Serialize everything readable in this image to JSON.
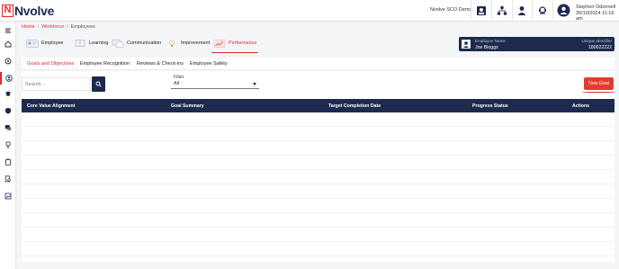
{
  "brand": {
    "mark": "N",
    "name": "Nvolve"
  },
  "header": {
    "org_name": "Nvolve SCO Demo",
    "icons": [
      "id-card-icon",
      "org-chart-icon",
      "users-icon",
      "support-icon"
    ],
    "user_name": "Stephen Odonnell",
    "user_datetime": "30/10/2024 11:16 am"
  },
  "sidebar": {
    "items": [
      {
        "icon": "menu-toggle-icon"
      },
      {
        "icon": "home-icon"
      },
      {
        "icon": "compass-icon"
      },
      {
        "icon": "person-badge-icon",
        "active": true
      },
      {
        "icon": "graduation-cap-icon"
      },
      {
        "icon": "shield-icon"
      },
      {
        "icon": "chat-icon"
      },
      {
        "icon": "trophy-icon"
      },
      {
        "icon": "clipboard-icon"
      },
      {
        "icon": "document-search-icon"
      },
      {
        "icon": "chart-icon"
      }
    ]
  },
  "breadcrumb": {
    "home": "Home",
    "workforce": "Workforce",
    "current": "Employees",
    "separator": "/"
  },
  "main_tabs": [
    {
      "label": "Employee",
      "icon": "employee-tab-icon",
      "active": false
    },
    {
      "label": "Learning",
      "icon": "learning-tab-icon",
      "active": false
    },
    {
      "label": "Communication",
      "icon": "communication-tab-icon",
      "active": false
    },
    {
      "label": "Improvement",
      "icon": "improvement-tab-icon",
      "active": false
    },
    {
      "label": "Performance",
      "icon": "performance-tab-icon",
      "active": true
    }
  ],
  "employee_card": {
    "name_label": "Employee Name",
    "name_value": "Joe Bloggs",
    "id_label": "Unique Identifier",
    "id_value": "180022222"
  },
  "sub_tabs": [
    {
      "label": "Goals and Objectives",
      "active": true
    },
    {
      "label": "Employee Recognition",
      "active": false
    },
    {
      "label": "Reviews & Check-ins",
      "active": false
    },
    {
      "label": "Employee Safety",
      "active": false
    }
  ],
  "toolbar": {
    "search_placeholder": "Search...",
    "filter_label": "Filter",
    "filter_value": "All",
    "new_goal_label": "New Goal"
  },
  "table": {
    "columns": [
      "Core Value Alignment",
      "Goal Summary",
      "Target Completion Date",
      "Progress Status",
      "Actions"
    ],
    "rows": []
  },
  "colors": {
    "accent": "#e02b2b",
    "navy": "#1d2a4d",
    "button_red": "#e53a2f"
  }
}
